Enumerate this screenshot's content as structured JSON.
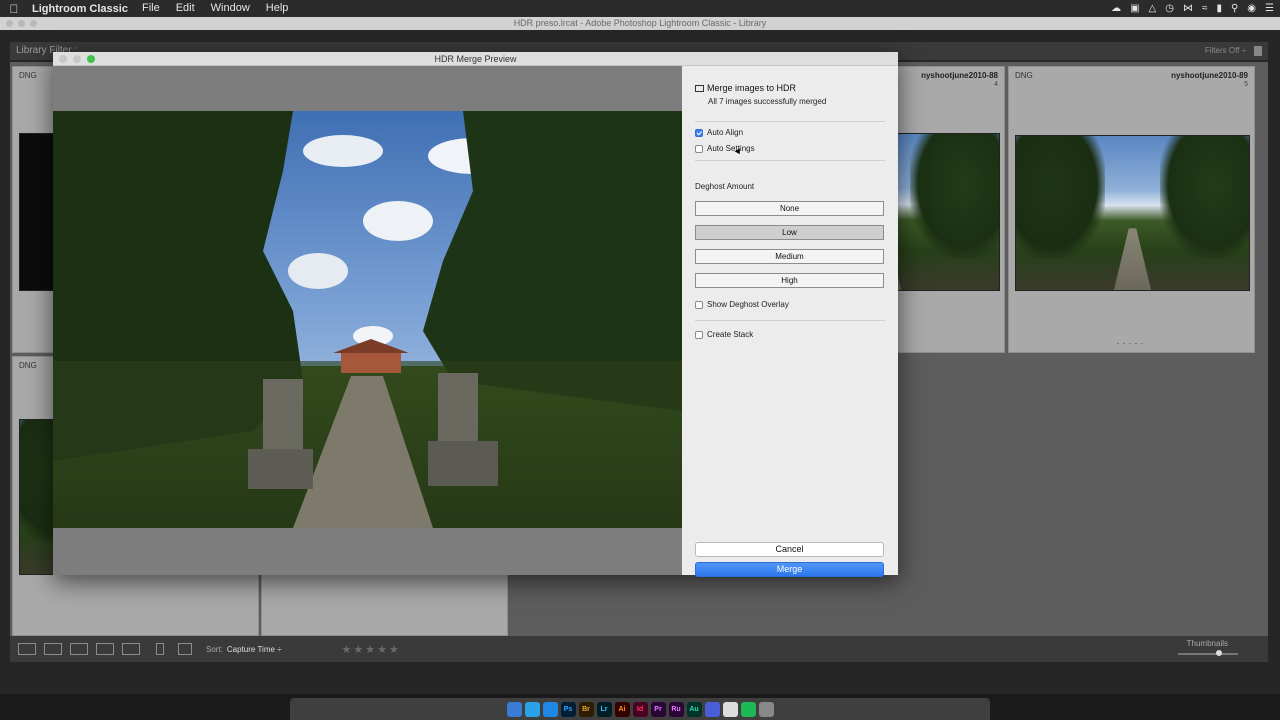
{
  "menubar": {
    "app_name": "Lightroom Classic",
    "menus": [
      "File",
      "Edit",
      "Window",
      "Help"
    ],
    "status_icons": [
      "creative-cloud-icon",
      "display-icon",
      "airplay-icon",
      "time-machine-icon",
      "bluetooth-icon",
      "wifi-icon",
      "battery-icon",
      "search-icon",
      "siri-icon",
      "menu-icon"
    ]
  },
  "window": {
    "title": "HDR preso.lrcat - Adobe Photoshop Lightroom Classic - Library"
  },
  "library": {
    "filter_bar_label": "Library Filter :",
    "filters_off": "Filters Off ÷",
    "cells": [
      {
        "format": "DNG",
        "filename": "",
        "index": ""
      },
      {
        "format": "",
        "filename": "nyshootjune2010-88",
        "index": "4"
      },
      {
        "format": "DNG",
        "filename": "nyshootjune2010-89",
        "index": "5"
      },
      {
        "format": "DNG",
        "filename": "",
        "index": ""
      }
    ]
  },
  "toolbar": {
    "sort_label": "Sort:",
    "sort_value": "Capture Time ÷",
    "stars": "★★★★★",
    "thumbnails_label": "Thumbnails"
  },
  "dialog": {
    "title": "HDR Merge Preview",
    "heading": "Merge images to HDR",
    "status": "All 7 images successfully merged",
    "auto_align_label": "Auto Align",
    "auto_align_checked": true,
    "auto_settings_label": "Auto Settings",
    "auto_settings_checked": false,
    "deghost_label": "Deghost Amount",
    "deghost_options": [
      "None",
      "Low",
      "Medium",
      "High"
    ],
    "deghost_selected": "Low",
    "show_overlay_label": "Show Deghost Overlay",
    "create_stack_label": "Create Stack",
    "cancel_label": "Cancel",
    "merge_label": "Merge"
  },
  "dock": {
    "apps": [
      "Finder",
      "Ch",
      "Sa",
      "Ps",
      "Br",
      "Lr",
      "Ai",
      "Id",
      "Pr",
      "Ru",
      "Au",
      "Ms",
      "Ma",
      "Sp",
      "Tr"
    ]
  },
  "colors": {
    "accent": "#3b82f0",
    "merge_button": "#2d76ec",
    "dialog_bg": "#ececec",
    "library_bg": "#5d5d5d"
  }
}
